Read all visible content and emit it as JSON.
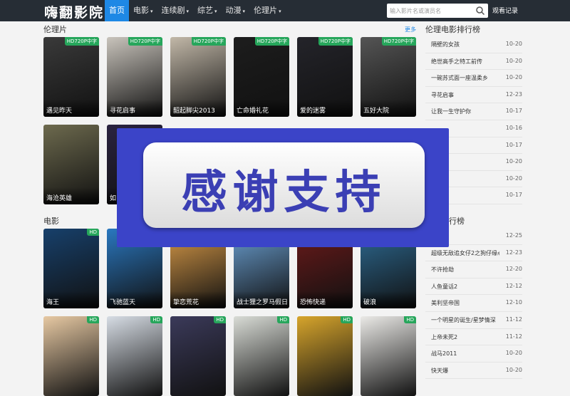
{
  "header": {
    "logo": "嗨翻影院",
    "nav": [
      {
        "label": "首页",
        "active": true,
        "dropdown": false
      },
      {
        "label": "电影",
        "active": false,
        "dropdown": true
      },
      {
        "label": "连续剧",
        "active": false,
        "dropdown": true
      },
      {
        "label": "综艺",
        "active": false,
        "dropdown": true
      },
      {
        "label": "动漫",
        "active": false,
        "dropdown": true
      },
      {
        "label": "伦理片",
        "active": false,
        "dropdown": true
      }
    ],
    "search_placeholder": "输入影片名或演员名",
    "history_label": "观看记录"
  },
  "section1": {
    "title": "伦理片",
    "more": "更多",
    "posters": [
      {
        "title": "遇见昨天",
        "badge": "HD720P中字",
        "color": "#3a3a3a"
      },
      {
        "title": "寻花启事",
        "badge": "HD720P中字",
        "color": "#c9c4bc"
      },
      {
        "title": "韶起脚尖2013",
        "badge": "HD720P中字",
        "color": "#c2b8a8"
      },
      {
        "title": "亡命婚礼花",
        "badge": "HD720P中字",
        "color": "#1d1d1d"
      },
      {
        "title": "爱的迷雾",
        "badge": "HD720P中字",
        "color": "#24242a"
      },
      {
        "title": "五好大院",
        "badge": "HD720P中字",
        "color": "#555555"
      },
      {
        "title": "海沧英雄",
        "badge": "",
        "color": "#6d6a4e"
      },
      {
        "title": "如",
        "badge": "",
        "color": "#2a2340"
      }
    ]
  },
  "section2": {
    "title": "电影",
    "posters": [
      {
        "title": "海王",
        "badge": "HD",
        "color": "#17406b"
      },
      {
        "title": "飞驰蓝天",
        "badge": "HD",
        "color": "#2a78c0"
      },
      {
        "title": "挚恋荒花",
        "badge": "HD",
        "color": "#d89a48"
      },
      {
        "title": "战士狸之罗马假日",
        "badge": "HD",
        "color": "#6a9fd1"
      },
      {
        "title": "恐怖快递",
        "badge": "HD",
        "color": "#6b1a1a"
      },
      {
        "title": "破浪",
        "badge": "HD",
        "color": "#2d6a92"
      },
      {
        "title": "",
        "badge": "HD",
        "color": "#e7c9a3"
      },
      {
        "title": "",
        "badge": "HD",
        "color": "#d7dde5"
      },
      {
        "title": "",
        "badge": "HD",
        "color": "#3b3a5a"
      },
      {
        "title": "",
        "badge": "HD",
        "color": "#d9dcd6"
      },
      {
        "title": "",
        "badge": "HD",
        "color": "#d7a52c"
      },
      {
        "title": "",
        "badge": "HD",
        "color": "#ebeae7"
      }
    ]
  },
  "ranking1": {
    "title": "伦理电影排行榜",
    "items": [
      {
        "num": "1",
        "name": "隔壁的女孩",
        "date": "10-20"
      },
      {
        "num": "2",
        "name": "绝世高手之特工前传",
        "date": "10-20"
      },
      {
        "num": "3",
        "name": "一碗苏式面一座温柔乡",
        "date": "10-20"
      },
      {
        "num": "4",
        "name": "寻花启事",
        "date": "12-23"
      },
      {
        "num": "5",
        "name": "让我一生守护你",
        "date": "10-17"
      },
      {
        "num": "6",
        "name": "",
        "date": "10-16"
      },
      {
        "num": "7",
        "name": "",
        "date": "10-17"
      },
      {
        "num": "8",
        "name": "",
        "date": "10-20"
      },
      {
        "num": "9",
        "name": "",
        "date": "10-20"
      },
      {
        "num": "10",
        "name": "",
        "date": "10-17"
      }
    ]
  },
  "ranking2": {
    "title": "行榜",
    "items": [
      {
        "num": "1",
        "name": "",
        "date": "12-25"
      },
      {
        "num": "2",
        "name": "超级无敌追女仔2之狗仔缘心",
        "date": "12-23"
      },
      {
        "num": "3",
        "name": "不许抢劫",
        "date": "12-20"
      },
      {
        "num": "4",
        "name": "人鱼童话2",
        "date": "12-12"
      },
      {
        "num": "5",
        "name": "美利坚帝国",
        "date": "12-10"
      },
      {
        "num": "6",
        "name": "一个明星的诞生/星梦情深",
        "date": "11-12"
      },
      {
        "num": "7",
        "name": "上帝未死2",
        "date": "11-12"
      },
      {
        "num": "8",
        "name": "战马2011",
        "date": "10-20"
      },
      {
        "num": "9",
        "name": "快天爆",
        "date": "10-20"
      }
    ]
  },
  "overlay": {
    "text": "感谢支持"
  }
}
